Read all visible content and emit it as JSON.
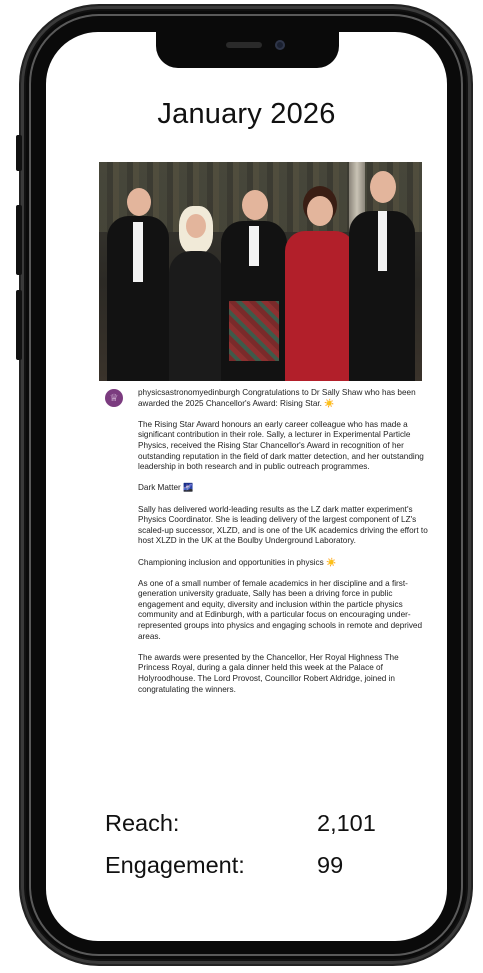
{
  "header": {
    "title": "January 2026"
  },
  "post": {
    "handle": "physicsastronomyedinburgh",
    "intro": "Congratulations to Dr Sally Shaw who has been awarded the 2025 Chancellor's Award: Rising Star. ☀️",
    "paragraphs": [
      "The Rising Star Award honours an early career colleague who has made a significant contribution in their role. Sally, a lecturer in Experimental Particle Physics, received the Rising Star Chancellor's Award in recognition of her outstanding reputation in the field of dark matter detection, and her outstanding leadership in both research and in public outreach programmes.",
      "Dark Matter 🌌",
      "Sally has delivered world-leading results as the LZ dark matter experiment's Physics Coordinator. She is leading delivery of the largest component of LZ's scaled-up successor, XLZD, and is one of the UK academics driving the effort to host XLZD in the UK at the Boulby Underground Laboratory.",
      "Championing inclusion and opportunities in physics ☀️",
      "As one of a small number of female academics in her discipline and a first-generation university graduate, Sally has been a driving force in public engagement and equity, diversity and inclusion within the particle physics community and at Edinburgh, with a particular focus on encouraging under-represented groups into physics and engaging schools in remote and deprived areas.",
      "The awards were presented by the Chancellor, Her Royal Highness The Princess Royal, during a gala dinner held this week at the Palace of Holyroodhouse. The Lord Provost, Councillor Robert Aldridge, joined in congratulating the winners."
    ]
  },
  "stats": {
    "reach_label": "Reach:",
    "reach_value": "2,101",
    "engagement_label": "Engagement:",
    "engagement_value": "99"
  },
  "colors": {
    "avatar": "#7b3b7f",
    "frame": "#0a0a0a"
  },
  "icons": {
    "avatar": "university-crest-icon",
    "camera": "front-camera-icon"
  }
}
